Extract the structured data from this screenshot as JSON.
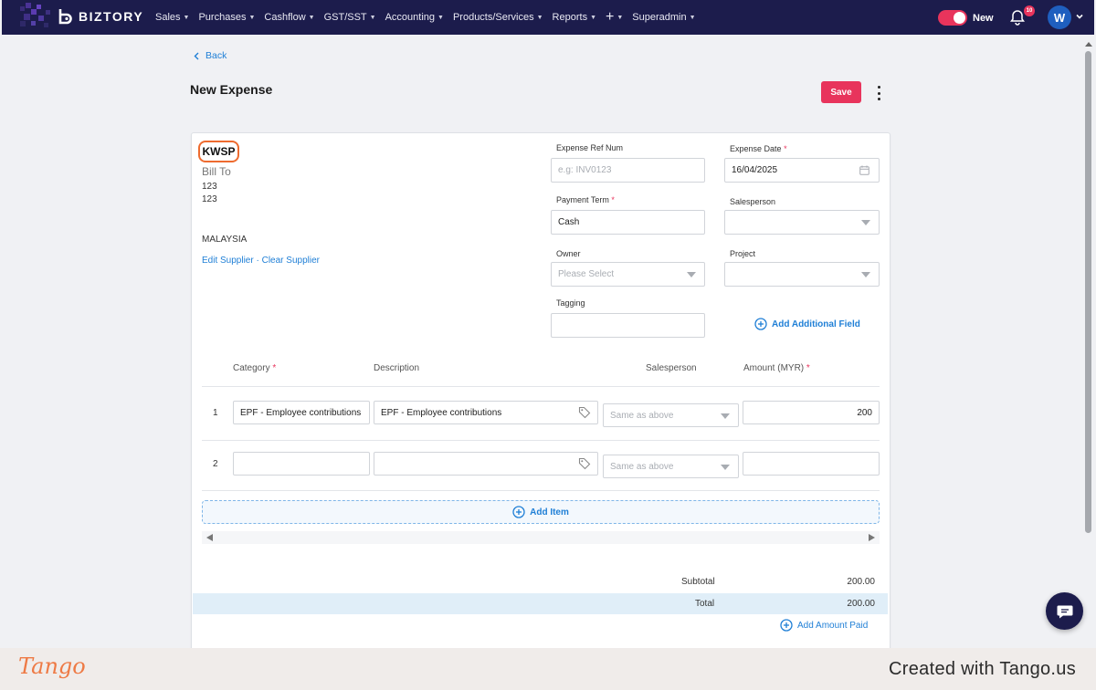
{
  "nav": {
    "brand": "BIZTORY",
    "menu": [
      {
        "label": "Sales",
        "caret": true
      },
      {
        "label": "Purchases",
        "caret": true
      },
      {
        "label": "Cashflow",
        "caret": true
      },
      {
        "label": "GST/SST",
        "caret": true
      },
      {
        "label": "Accounting",
        "caret": true
      },
      {
        "label": "Products/Services",
        "caret": true
      },
      {
        "label": "Reports",
        "caret": true
      },
      {
        "label": "+",
        "caret": true
      },
      {
        "label": "Superadmin",
        "caret": true
      }
    ],
    "toggle_label": "New",
    "toggle_on": true,
    "notification_count": "10",
    "avatar_initial": "W"
  },
  "page": {
    "back_label": "Back",
    "title": "New Expense",
    "save_label": "Save"
  },
  "supplier": {
    "name": "KWSP",
    "bill_to_label": "Bill To",
    "address_lines": [
      "123",
      "123"
    ],
    "country": "MALAYSIA",
    "edit_link": "Edit Supplier",
    "separator": "·",
    "clear_link": "Clear Supplier"
  },
  "fields": {
    "ref_num": {
      "label": "Expense Ref Num",
      "placeholder": "e.g: INV0123",
      "value": ""
    },
    "date": {
      "label": "Expense Date",
      "value": "16/04/2025",
      "required": "*"
    },
    "payment_term": {
      "label": "Payment Term",
      "value": "Cash",
      "required": "*"
    },
    "salesperson": {
      "label": "Salesperson",
      "value": ""
    },
    "owner": {
      "label": "Owner",
      "placeholder": "Please Select"
    },
    "project": {
      "label": "Project",
      "value": ""
    },
    "tagging": {
      "label": "Tagging",
      "value": ""
    },
    "add_field_label": "Add Additional Field"
  },
  "items": {
    "headers": {
      "category": "Category",
      "description": "Description",
      "salesperson": "Salesperson",
      "amount": "Amount (MYR)",
      "required": "*"
    },
    "rows": [
      {
        "num": "1",
        "category": "EPF - Employee contributions",
        "description": "EPF - Employee contributions",
        "salesperson": "Same as above",
        "amount": "200"
      },
      {
        "num": "2",
        "category": "",
        "description": "",
        "salesperson": "Same as above",
        "amount": ""
      }
    ],
    "add_item_label": "Add Item"
  },
  "summary": {
    "subtotal_label": "Subtotal",
    "subtotal": "200.00",
    "total_label": "Total",
    "total": "200.00",
    "add_paid_label": "Add Amount Paid"
  },
  "footer": {
    "logo": "Tango",
    "created": "Created with Tango.us"
  },
  "colors": {
    "nav_bg": "#1c1c4c",
    "accent": "#e8345c",
    "link": "#1f7fd6",
    "highlight": "#ee6b2f"
  }
}
